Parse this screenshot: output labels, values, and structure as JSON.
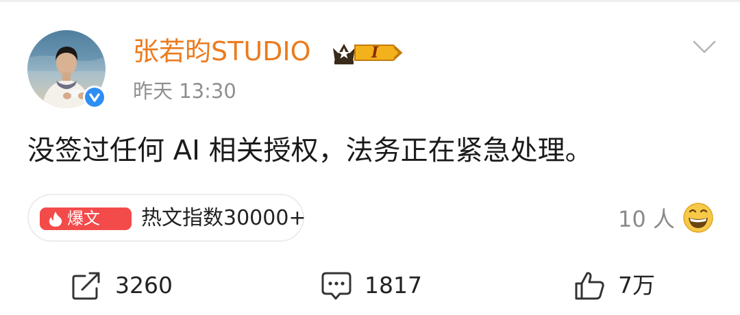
{
  "post": {
    "author": {
      "name": "张若昀STUDIO",
      "vip_level": "I",
      "verified": true
    },
    "time": "昨天 13:30",
    "content": "没签过任何 AI 相关授权，法务正在紧急处理。"
  },
  "hot_index": {
    "tag": "爆文",
    "text": "热文指数30000+"
  },
  "reactions": {
    "count_text": "10 人",
    "icon": "grin-emoji-icon"
  },
  "actions": {
    "repost": "3260",
    "comment": "1817",
    "like": "7万"
  },
  "colors": {
    "username": "#eb7b1e",
    "hot_tag_bg": "#f34a4a",
    "verified": "#2d8ef3",
    "vip_gold": "#f3b21c"
  }
}
